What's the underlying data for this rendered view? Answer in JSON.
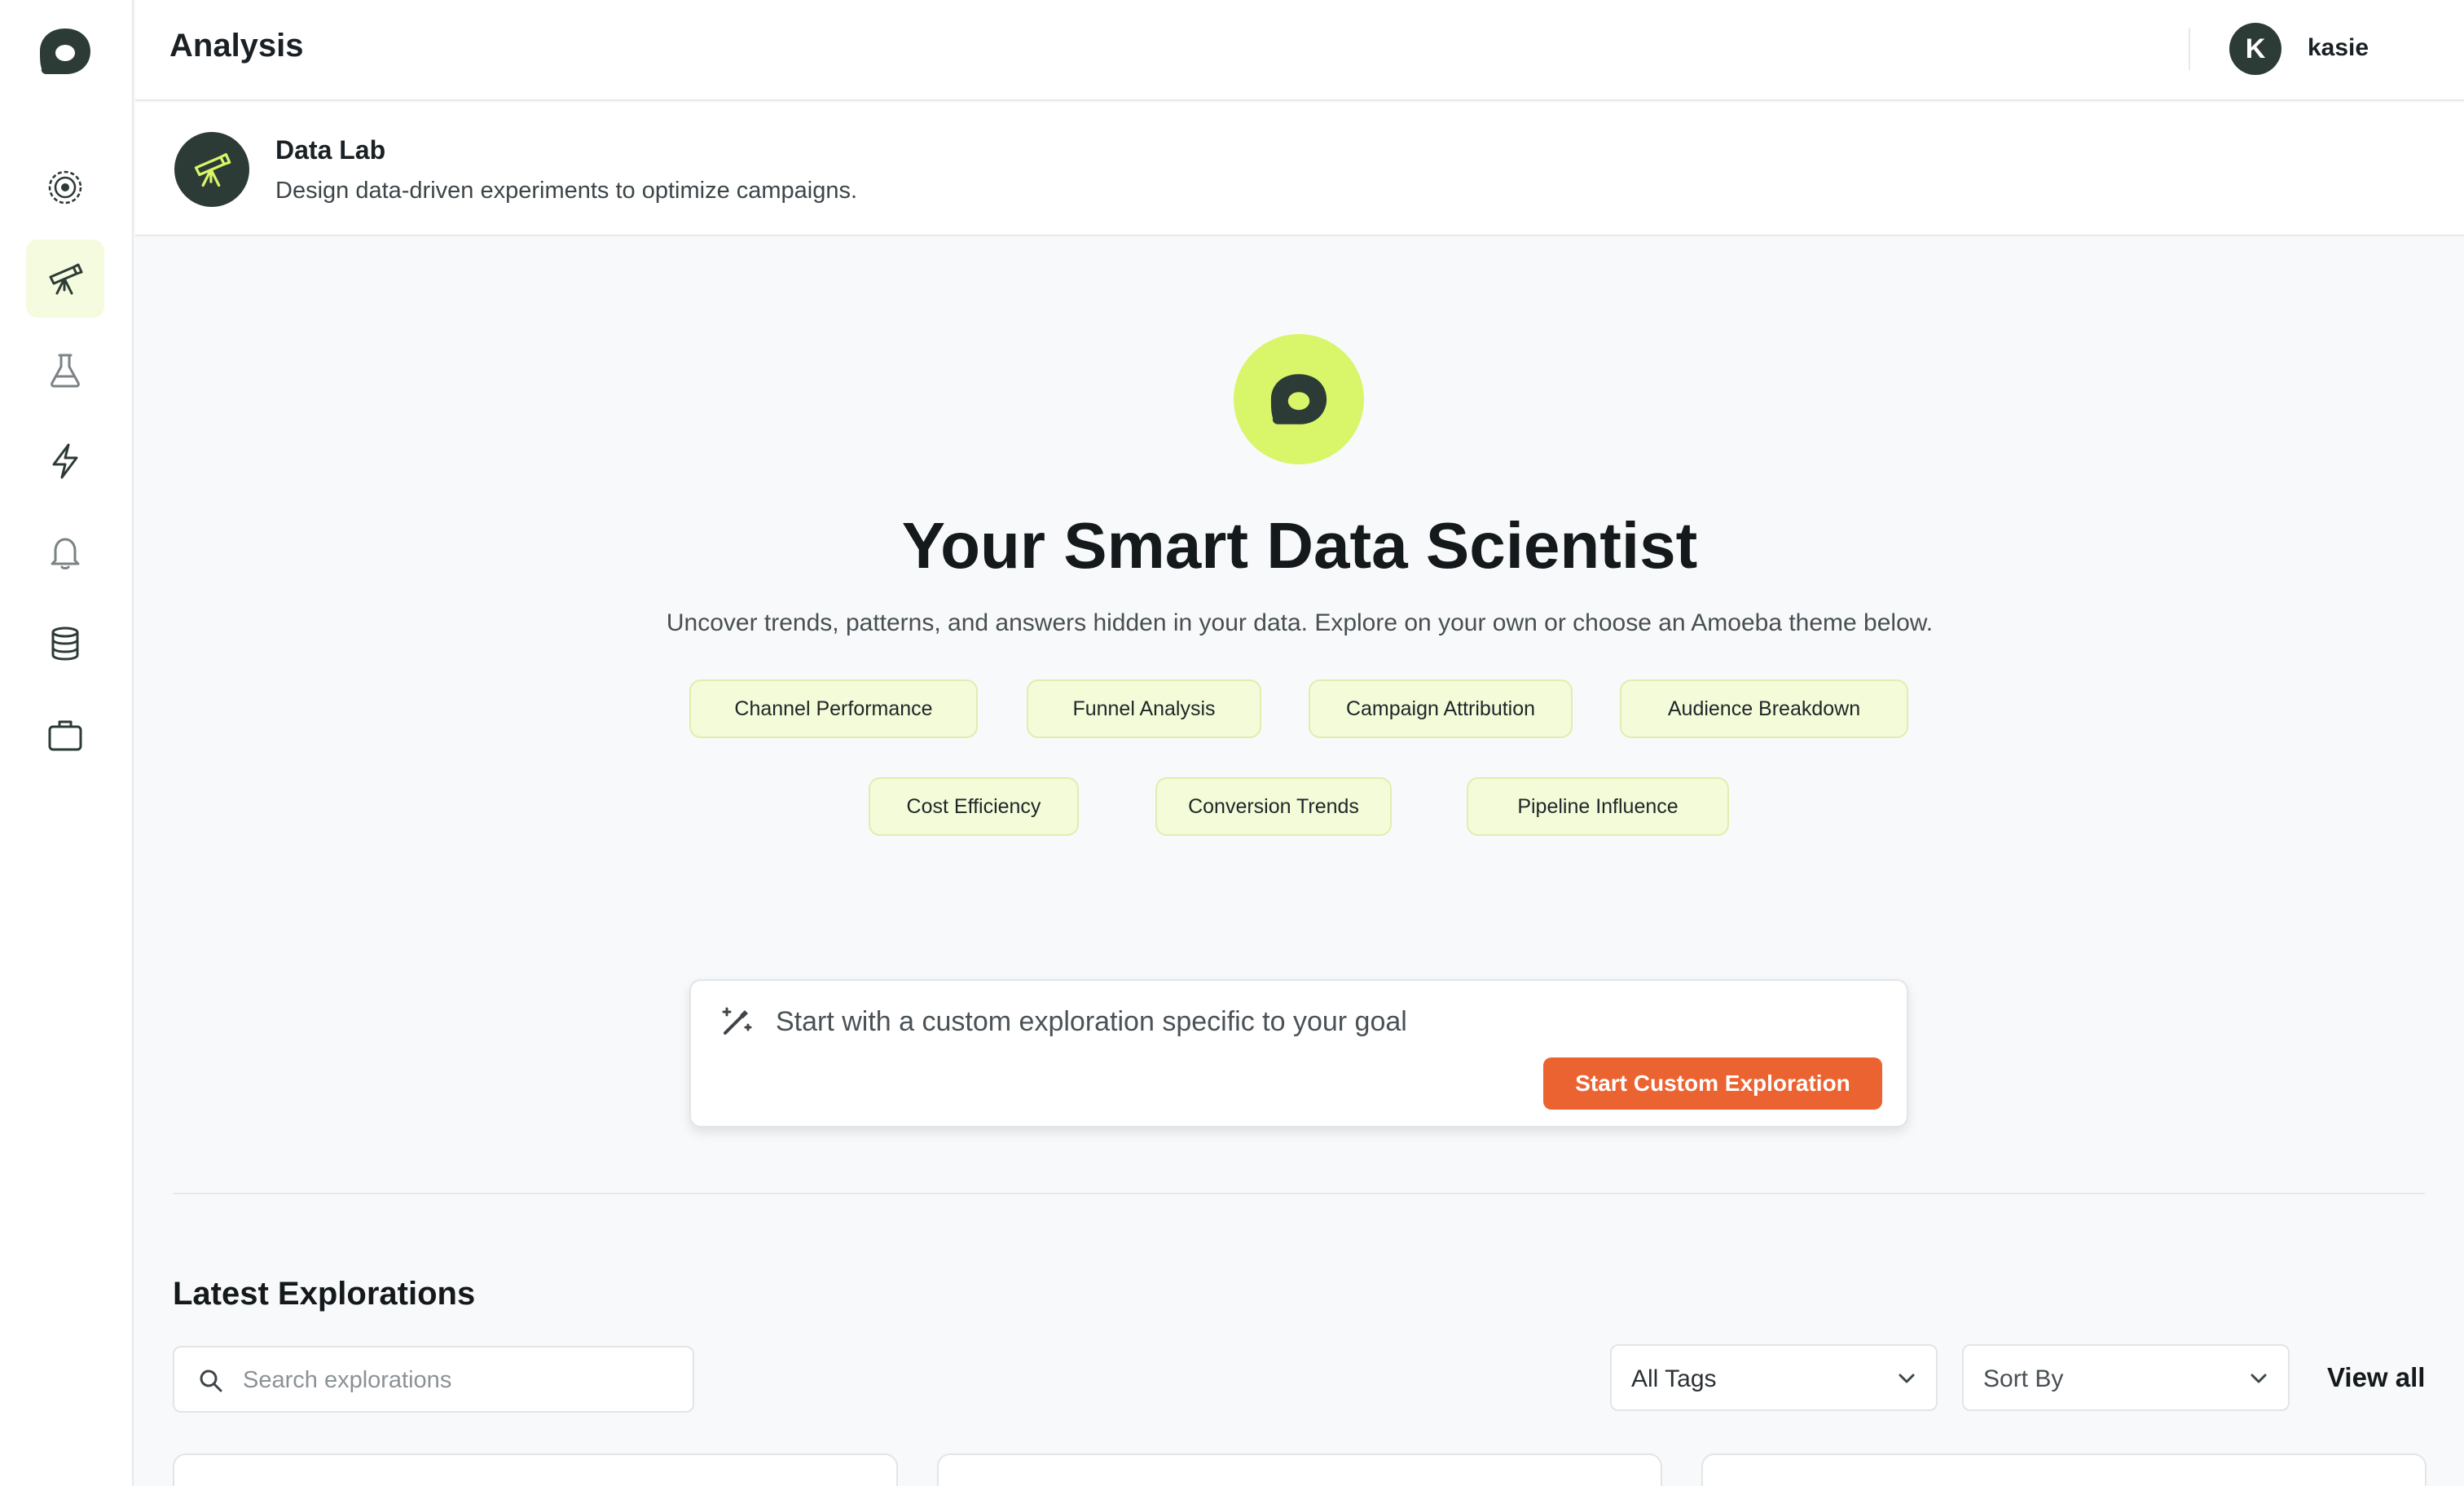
{
  "header": {
    "title": "Analysis",
    "user": {
      "initial": "K",
      "name": "kasie"
    }
  },
  "sidebar": {
    "items": [
      {
        "name": "insights",
        "icon": "orbit-icon"
      },
      {
        "name": "data-lab",
        "icon": "telescope-icon",
        "active": true
      },
      {
        "name": "experiments",
        "icon": "flask-icon"
      },
      {
        "name": "automations",
        "icon": "lightning-icon"
      },
      {
        "name": "alerts",
        "icon": "bell-icon"
      },
      {
        "name": "data-sources",
        "icon": "database-icon"
      },
      {
        "name": "workspace",
        "icon": "briefcase-icon"
      }
    ]
  },
  "subheader": {
    "title": "Data Lab",
    "description": "Design data-driven experiments to optimize campaigns."
  },
  "hero": {
    "title": "Your Smart Data Scientist",
    "description": "Uncover trends, patterns, and answers hidden in your data. Explore on your own or choose an Amoeba theme below."
  },
  "themes": [
    "Channel Performance",
    "Funnel Analysis",
    "Campaign Attribution",
    "Audience Breakdown",
    "Cost Efficiency",
    "Conversion Trends",
    "Pipeline Influence"
  ],
  "custom_exploration": {
    "placeholder": "Start with a custom exploration specific to your goal",
    "button_label": "Start Custom Exploration"
  },
  "latest": {
    "title": "Latest Explorations",
    "search_placeholder": "Search explorations",
    "tags_select": "All Tags",
    "sort_select": "Sort By",
    "view_all": "View all"
  },
  "colors": {
    "brand_dark": "#2d3b36",
    "brand_lime": "#d9f56a",
    "accent_orange": "#ec6332",
    "chip_bg": "#f3fbd9"
  }
}
